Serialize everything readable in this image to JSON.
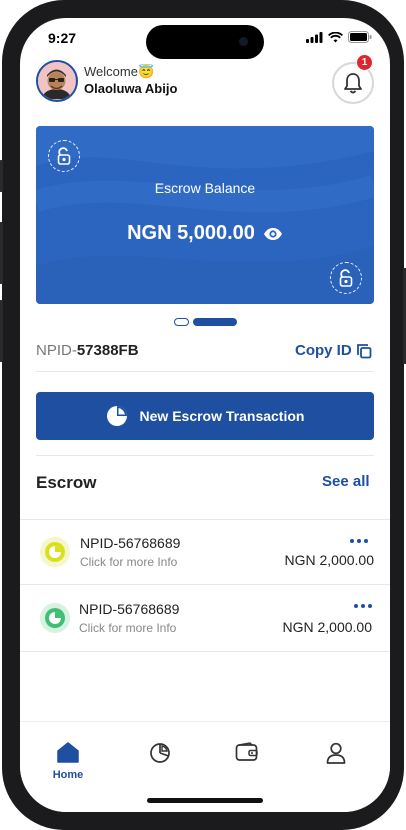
{
  "status_bar": {
    "time": "9:27"
  },
  "header": {
    "welcome": "Welcome",
    "welcome_emoji": "😇",
    "username": "Olaoluwa Abijo",
    "notification_count": "1"
  },
  "balance_card": {
    "label": "Escrow Balance",
    "amount": "NGN 5,000.00",
    "card_color": "#2c65bf",
    "pagination": {
      "pages": 2,
      "active_index": 1
    }
  },
  "npid": {
    "prefix": "NPID-",
    "value": "57388FB",
    "copy_label": "Copy ID"
  },
  "actions": {
    "new_escrow_label": "New Escrow Transaction"
  },
  "escrow_section": {
    "title": "Escrow",
    "see_all_label": "See all",
    "items": [
      {
        "id": "NPID-56768689",
        "subtitle": "Click for more Info",
        "amount": "NGN 2,000.00",
        "status_color": "#d9e021",
        "status_bg": "#f4f7c8"
      },
      {
        "id": "NPID-56768689",
        "subtitle": "Click for more Info",
        "amount": "NGN 2,000.00",
        "status_color": "#3fbf74",
        "status_bg": "#d6f2e1"
      }
    ]
  },
  "tab_bar": {
    "tabs": [
      {
        "icon": "home-icon",
        "label": "Home",
        "active": true
      },
      {
        "icon": "pie-chart-icon",
        "label": "",
        "active": false
      },
      {
        "icon": "wallet-icon",
        "label": "",
        "active": false
      },
      {
        "icon": "profile-icon",
        "label": "",
        "active": false
      }
    ]
  },
  "colors": {
    "primary": "#1e4fa0",
    "badge": "#e0262b"
  }
}
